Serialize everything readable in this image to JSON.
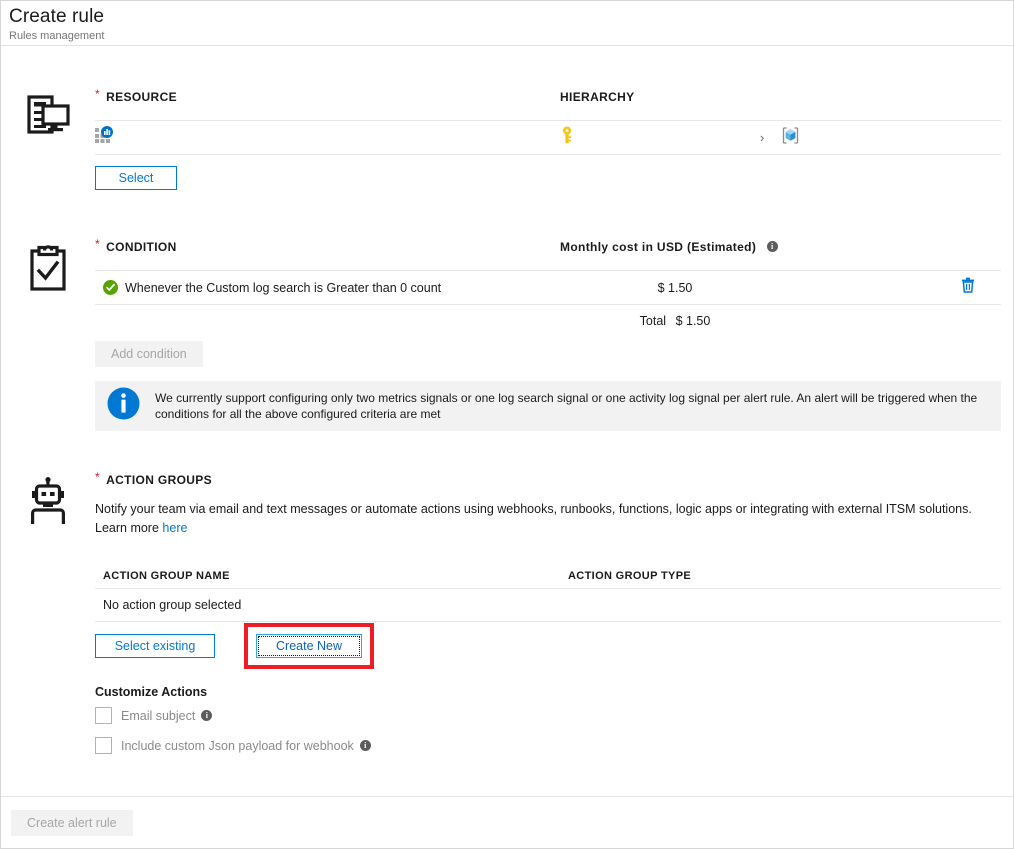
{
  "header": {
    "title": "Create rule",
    "subtitle": "Rules management"
  },
  "resource": {
    "icon": "server-monitor-icon",
    "label": "RESOURCE",
    "required_marker": "*",
    "hierarchy_label": "HIERARCHY",
    "resource_item_icon": "application-insights-icon",
    "hierarchy": {
      "subscription_icon": "key-icon",
      "separator": "›",
      "resource_group_icon": "resource-group-box-icon"
    },
    "select_button": "Select"
  },
  "condition": {
    "icon": "clipboard-check-icon",
    "label": "CONDITION",
    "required_marker": "*",
    "cost_column_label": "Monthly cost in USD (Estimated)",
    "cost_info_icon": "info-icon",
    "rows": [
      {
        "status_icon": "check-circle-icon",
        "text": "Whenever the Custom log search is Greater than 0 count",
        "cost": "$ 1.50",
        "delete_icon": "trash-icon"
      }
    ],
    "total_label": "Total",
    "total_value": "$ 1.50",
    "add_condition_button": "Add condition",
    "banner": {
      "icon": "info-icon",
      "text": "We currently support configuring only two metrics signals or one log search signal or one activity log signal per alert rule. An alert will be triggered when the conditions for all the above configured criteria are met"
    }
  },
  "action_groups": {
    "icon": "robot-icon",
    "label": "ACTION GROUPS",
    "required_marker": "*",
    "description": "Notify your team via email and text messages or automate actions using webhooks, runbooks, functions, logic apps or integrating with external ITSM solutions.",
    "learn_more_prefix": "Learn more",
    "learn_more_link": "here",
    "table": {
      "columns": [
        "ACTION GROUP NAME",
        "ACTION GROUP TYPE"
      ],
      "empty_message": "No action group selected"
    },
    "select_existing_button": "Select existing",
    "create_new_button": "Create New",
    "customize": {
      "title": "Customize Actions",
      "checkboxes": [
        {
          "label": "Email subject",
          "checked": false,
          "info_icon": "info-icon"
        },
        {
          "label": "Include custom Json payload for webhook",
          "checked": false,
          "info_icon": "info-icon"
        }
      ]
    }
  },
  "footer": {
    "create_alert_rule_button": "Create alert rule"
  },
  "colors": {
    "accent_blue": "#0078d4",
    "required_red": "#e81123",
    "annotation_red": "#ee1c25",
    "success_green": "#57a300",
    "disabled_grey": "#a6a6a6",
    "banner_grey": "#f2f2f2",
    "key_yellow": "#f5c518"
  }
}
